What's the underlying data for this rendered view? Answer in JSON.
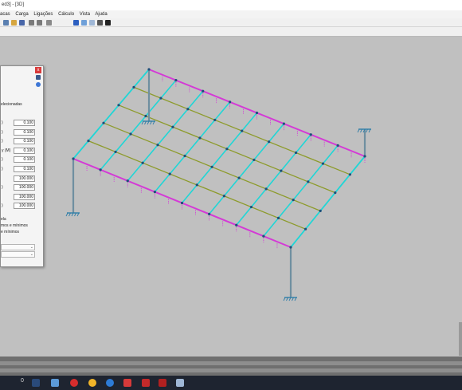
{
  "window": {
    "title": "ed3] - [3D]"
  },
  "menu": {
    "items": [
      "acas",
      "Carga",
      "Ligações",
      "Cálculo",
      "Vista",
      "Ajuda"
    ]
  },
  "dialog": {
    "close_label": "x",
    "text_selected": "elecionadas",
    "params": [
      {
        "label": ")",
        "value": "0.100"
      },
      {
        "label": ")",
        "value": "0.100"
      },
      {
        "label": ")",
        "value": "0.100"
      },
      {
        "label": "y (M)",
        "value": "0.100"
      },
      {
        "label": ")",
        "value": "0.100"
      },
      {
        "label": ")",
        "value": "0.100"
      },
      {
        "label": "",
        "value": "100.000"
      },
      {
        "label": ")",
        "value": "100.000"
      },
      {
        "label": "",
        "value": "100.000"
      },
      {
        "label": ")",
        "value": "100.000"
      }
    ],
    "option1": "ela",
    "option2": "mos e mínimos",
    "option3": "e mínimos"
  },
  "taskbar": {
    "badge": "0"
  },
  "colors": {
    "canvas": "#c0c0c0",
    "beam_magenta": "#d43ad6",
    "beam_cyan": "#20d6d6",
    "beam_olive": "#8d9b2c",
    "column": "#6f8fa0",
    "support": "#2f7ea8",
    "node": "#1e4f7a"
  },
  "icons": {
    "toolbar": [
      "new-icon",
      "open-icon",
      "save-icon",
      "undo-icon",
      "redo-icon",
      "view-icon",
      "grid-icon",
      "close-icon",
      "zoom-icon"
    ],
    "taskbar": [
      "windows-icon",
      "explorer-icon",
      "chrome-icon",
      "media-icon",
      "app-icon",
      "app-icon",
      "app-icon",
      "app-icon"
    ]
  }
}
